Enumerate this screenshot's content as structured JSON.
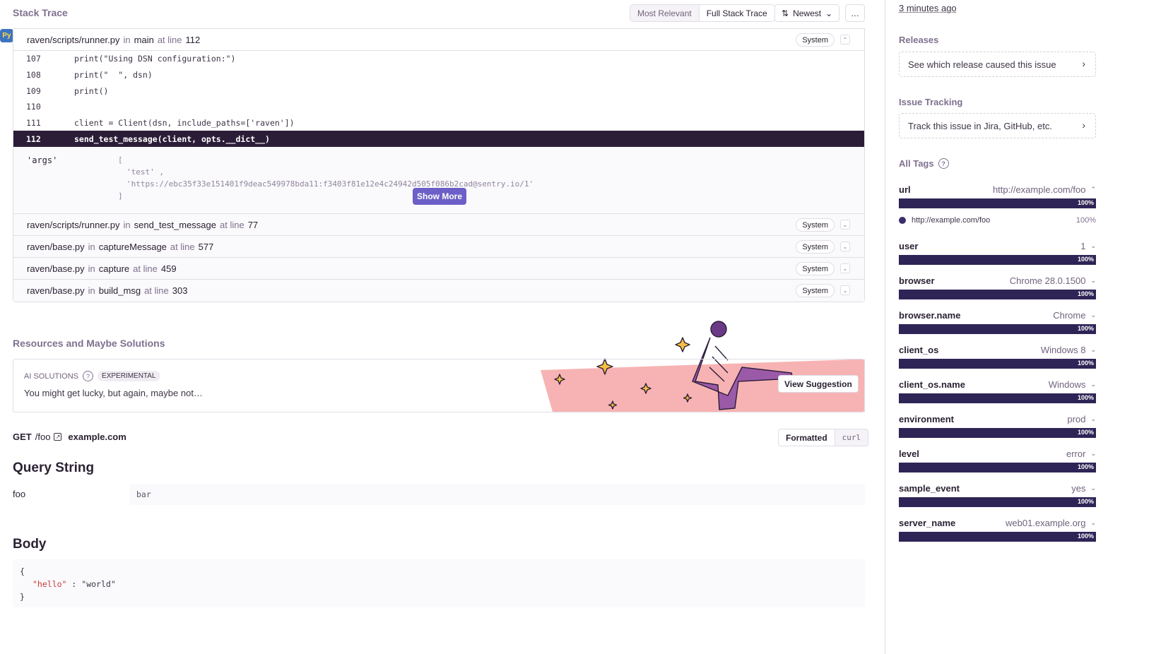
{
  "stack_trace": {
    "title": "Stack Trace",
    "view_options": [
      "Most Relevant",
      "Full Stack Trace"
    ],
    "sort_label": "Newest",
    "more_label": "…",
    "frames": [
      {
        "file": "raven/scripts/runner.py",
        "in": "in",
        "func": "main",
        "at": "at line",
        "line": "112",
        "badge": "System",
        "toggle": "⌃"
      },
      {
        "file": "raven/scripts/runner.py",
        "in": "in",
        "func": "send_test_message",
        "at": "at line",
        "line": "77",
        "badge": "System",
        "toggle": "⌄"
      },
      {
        "file": "raven/base.py",
        "in": "in",
        "func": "captureMessage",
        "at": "at line",
        "line": "577",
        "badge": "System",
        "toggle": "⌄"
      },
      {
        "file": "raven/base.py",
        "in": "in",
        "func": "capture",
        "at": "at line",
        "line": "459",
        "badge": "System",
        "toggle": "⌄"
      },
      {
        "file": "raven/base.py",
        "in": "in",
        "func": "build_msg",
        "at": "at line",
        "line": "303",
        "badge": "System",
        "toggle": "⌄"
      }
    ],
    "code_lines": [
      {
        "no": "107",
        "code": "print(\"Using DSN configuration:\")"
      },
      {
        "no": "108",
        "code": "print(\"  \", dsn)"
      },
      {
        "no": "109",
        "code": "print()"
      },
      {
        "no": "110",
        "code": ""
      },
      {
        "no": "111",
        "code": "client = Client(dsn, include_paths=['raven'])"
      },
      {
        "no": "112",
        "code": "send_test_message(client, opts.__dict__)"
      }
    ],
    "vars": {
      "key": "'args'",
      "lines": [
        "[",
        "'test' ,",
        "'https://ebc35f33e151401f9deac549978bda11:f3403f81e12e4c24942d505f086b2cad@sentry.io/1'",
        "]"
      ],
      "show_more": "Show More"
    }
  },
  "resources": {
    "title": "Resources and Maybe Solutions",
    "ai_label": "AI SOLUTIONS",
    "help_glyph": "?",
    "badge": "EXPERIMENTAL",
    "text": "You might get lucky, but again, maybe not…",
    "button": "View Suggestion"
  },
  "request": {
    "method": "GET",
    "path": "/foo",
    "host": "example.com",
    "formats": [
      "Formatted",
      "curl"
    ],
    "query_title": "Query String",
    "query": [
      {
        "key": "foo",
        "value": "bar"
      }
    ],
    "body_title": "Body",
    "body_lines": [
      "{",
      "\"hello\"",
      ":",
      "\"world\"",
      "}"
    ]
  },
  "sidebar": {
    "last_seen": "3 minutes ago",
    "releases_title": "Releases",
    "releases_card": "See which release caused this issue",
    "tracking_title": "Issue Tracking",
    "tracking_card": "Track this issue in Jira, GitHub, etc.",
    "tags_title": "All Tags",
    "help_glyph": "?",
    "chevron": "›",
    "tags": [
      {
        "key": "url",
        "value": "http://example.com/foo",
        "pct": "100%",
        "fraction": 1.0,
        "expanded": "⌃"
      },
      {
        "key": "user",
        "value": "1",
        "pct": "100%",
        "fraction": 1.0,
        "expanded": "⌄"
      },
      {
        "key": "browser",
        "value": "Chrome 28.0.1500",
        "pct": "100%",
        "fraction": 1.0,
        "expanded": "⌄"
      },
      {
        "key": "browser.name",
        "value": "Chrome",
        "pct": "100%",
        "fraction": 1.0,
        "expanded": "⌄"
      },
      {
        "key": "client_os",
        "value": "Windows 8",
        "pct": "100%",
        "fraction": 1.0,
        "expanded": "⌄"
      },
      {
        "key": "client_os.name",
        "value": "Windows",
        "pct": "100%",
        "fraction": 1.0,
        "expanded": "⌄"
      },
      {
        "key": "environment",
        "value": "prod",
        "pct": "100%",
        "fraction": 1.0,
        "expanded": "⌄"
      },
      {
        "key": "level",
        "value": "error",
        "pct": "100%",
        "fraction": 1.0,
        "expanded": "⌄"
      },
      {
        "key": "sample_event",
        "value": "yes",
        "pct": "100%",
        "fraction": 1.0,
        "expanded": "⌄"
      },
      {
        "key": "server_name",
        "value": "web01.example.org",
        "pct": "100%",
        "fraction": 1.0,
        "expanded": "⌄"
      }
    ],
    "url_detail": {
      "value": "http://example.com/foo",
      "pct": "100%"
    }
  },
  "colors": {
    "accent": "#6c5fc7",
    "bar": "#3c2e6b",
    "active_line": "#2b1d38",
    "illustration_bg": "#f7b3b3"
  }
}
